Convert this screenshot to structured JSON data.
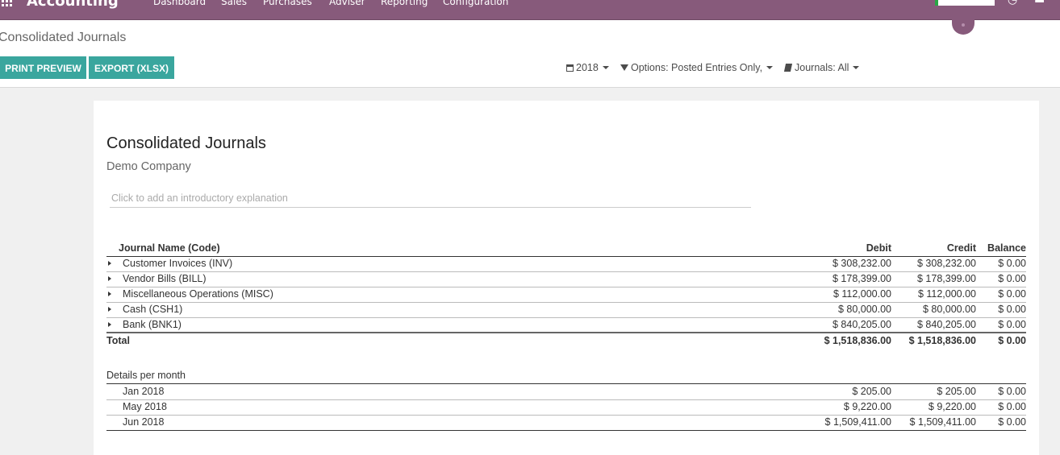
{
  "navbar": {
    "app_title": "Accounting",
    "menu": [
      "Dashboard",
      "Sales",
      "Purchases",
      "Adviser",
      "Reporting",
      "Configuration"
    ],
    "bg_color": "#875a7b"
  },
  "control_panel": {
    "breadcrumb": "Consolidated Journals",
    "buttons": {
      "print_preview": "PRINT PREVIEW",
      "export": "EXPORT (XLSX)"
    },
    "filters": {
      "date": "2018",
      "options": "Options: Posted Entries Only,",
      "journals": "Journals: All"
    },
    "icons": [
      "calendar-icon",
      "filter-icon",
      "book-icon"
    ],
    "accent_color": "#3aa69e"
  },
  "report": {
    "title": "Consolidated Journals",
    "company": "Demo Company",
    "intro_placeholder": "Click to add an introductory explanation",
    "columns": {
      "name": "Journal Name (Code)",
      "debit": "Debit",
      "credit": "Credit",
      "balance": "Balance"
    },
    "journals": [
      {
        "name": "Customer Invoices (INV)",
        "debit": "$ 308,232.00",
        "credit": "$ 308,232.00",
        "balance": "$ 0.00"
      },
      {
        "name": "Vendor Bills (BILL)",
        "debit": "$ 178,399.00",
        "credit": "$ 178,399.00",
        "balance": "$ 0.00"
      },
      {
        "name": "Miscellaneous Operations (MISC)",
        "debit": "$ 112,000.00",
        "credit": "$ 112,000.00",
        "balance": "$ 0.00"
      },
      {
        "name": "Cash (CSH1)",
        "debit": "$ 80,000.00",
        "credit": "$ 80,000.00",
        "balance": "$ 0.00"
      },
      {
        "name": "Bank (BNK1)",
        "debit": "$ 840,205.00",
        "credit": "$ 840,205.00",
        "balance": "$ 0.00"
      }
    ],
    "total": {
      "label": "Total",
      "debit": "$ 1,518,836.00",
      "credit": "$ 1,518,836.00",
      "balance": "$ 0.00"
    },
    "months_heading": "Details per month",
    "months": [
      {
        "name": "Jan 2018",
        "debit": "$ 205.00",
        "credit": "$ 205.00",
        "balance": "$ 0.00"
      },
      {
        "name": "May 2018",
        "debit": "$ 9,220.00",
        "credit": "$ 9,220.00",
        "balance": "$ 0.00"
      },
      {
        "name": "Jun 2018",
        "debit": "$ 1,509,411.00",
        "credit": "$ 1,509,411.00",
        "balance": "$ 0.00"
      }
    ]
  }
}
